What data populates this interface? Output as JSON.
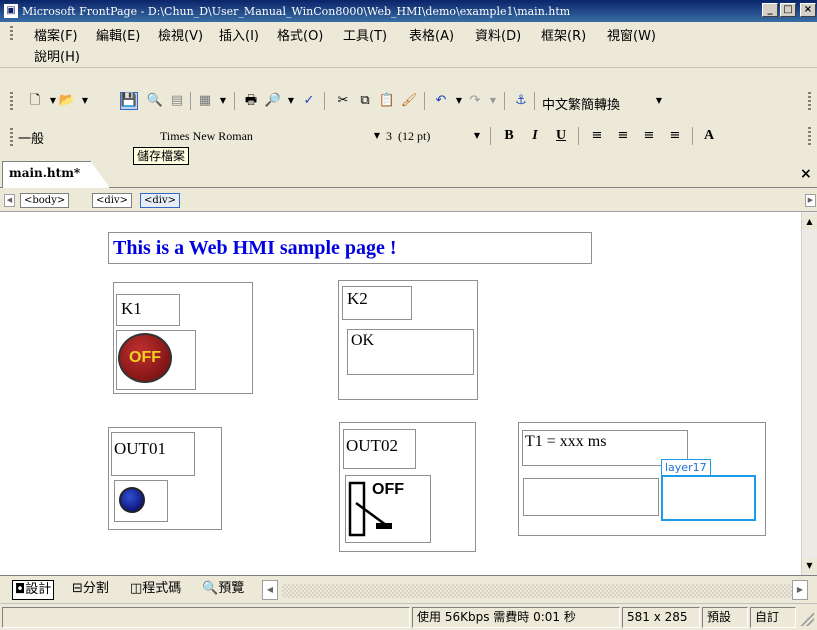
{
  "window": {
    "title": "Microsoft FrontPage - D:\\Chun_D\\User_Manual_WinCon8000\\Web_HMI\\demo\\example1\\main.htm",
    "app_icon": "frontpage-icon",
    "minimize": "_",
    "maximize": "□",
    "close": "×"
  },
  "menu": {
    "items": [
      "檔案(F)",
      "編輯(E)",
      "檢視(V)",
      "插入(I)",
      "格式(O)",
      "工具(T)",
      "表格(A)",
      "資料(D)",
      "框架(R)",
      "視窗(W)",
      "說明(H)"
    ]
  },
  "toolbar": {
    "tooltip": "儲存檔案",
    "cjk_convert": "中文繁簡轉換",
    "style_value": "一般",
    "font_value": "Times New Roman",
    "size_value": "3  (12 pt)",
    "bold": "B",
    "italic": "I",
    "underline": "U",
    "grow_font": "A"
  },
  "tabs": {
    "active": "main.htm*",
    "close": "×"
  },
  "tag_path": [
    "<body>",
    "<div>",
    "<div>"
  ],
  "page": {
    "heading": "This is a Web HMI sample page !",
    "k1_label": "K1",
    "k1_button": "OFF",
    "k2_label": "K2",
    "k2_status": "OK",
    "out01_label": "OUT01",
    "out02_label": "OUT02",
    "out02_switch": "OFF",
    "t1_label": "T1 = xxx ms",
    "layer_label": "layer17"
  },
  "view_tabs": [
    "設計",
    "分割",
    "程式碼",
    "預覽"
  ],
  "status": {
    "download": "使用 56Kbps 需費時 0:01 秒",
    "dimensions": "581 x 285",
    "mode1": "預設",
    "mode2": "自訂"
  }
}
